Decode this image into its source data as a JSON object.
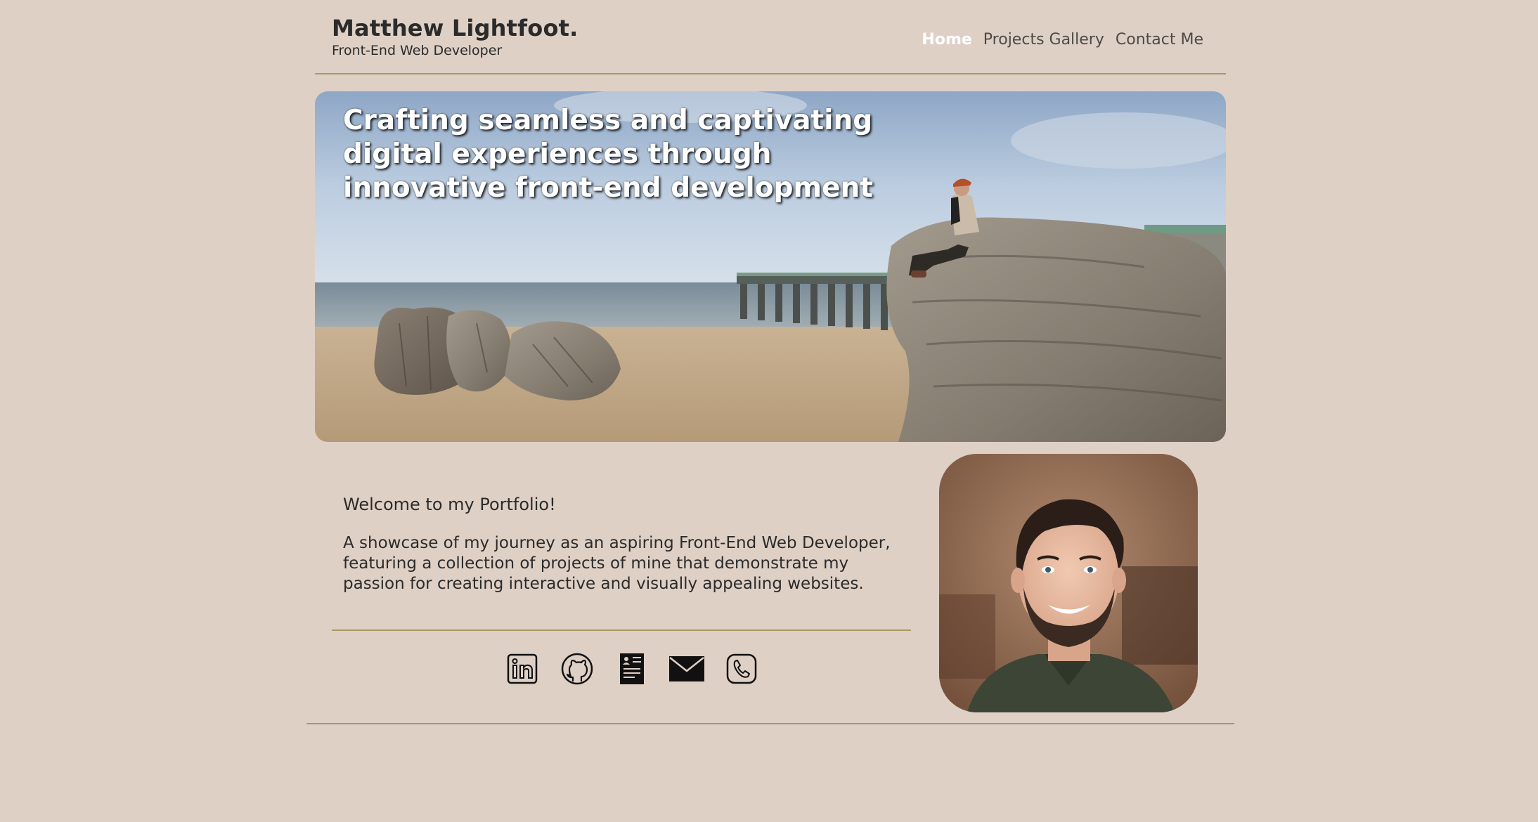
{
  "header": {
    "name": "Matthew Lightfoot.",
    "subtitle": "Front-End Web Developer",
    "nav": [
      {
        "label": "Home",
        "active": true
      },
      {
        "label": "Projects Gallery",
        "active": false
      },
      {
        "label": "Contact Me",
        "active": false
      }
    ]
  },
  "hero": {
    "tagline": "Crafting seamless and captivating digital experiences through innovative front-end development"
  },
  "about": {
    "welcome": "Welcome to my Portfolio!",
    "intro": "A showcase of my journey as an aspiring Front-End Web Developer, featuring a collection of projects of mine that demonstrate my passion for creating interactive and visually appealing websites."
  },
  "socials": [
    {
      "icon": "linkedin-icon"
    },
    {
      "icon": "github-icon"
    },
    {
      "icon": "resume-icon"
    },
    {
      "icon": "email-icon"
    },
    {
      "icon": "phone-icon"
    }
  ],
  "colors": {
    "background": "#dfd0c6",
    "accent_line": "#a99868",
    "text": "#2b2b2b",
    "nav_active": "#ffffff"
  }
}
